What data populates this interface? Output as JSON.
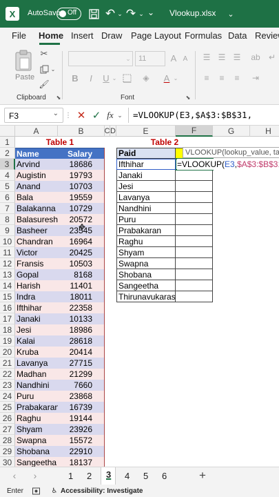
{
  "titlebar": {
    "autosave": "AutoSave",
    "toggle": "Off",
    "filename": "Vlookup.xlsx"
  },
  "tabs": [
    "File",
    "Home",
    "Insert",
    "Draw",
    "Page Layout",
    "Formulas",
    "Data",
    "Review"
  ],
  "ribbon": {
    "clipboard": "Clipboard",
    "paste": "Paste",
    "font_group": "Font",
    "font_size": "11"
  },
  "formula_bar": {
    "name_box": "F3",
    "fx": "fx",
    "formula": "=VLOOKUP(E3,$A$3:$B$31,"
  },
  "columns": [
    "A",
    "B",
    "C",
    "D",
    "E",
    "F",
    "G",
    "H"
  ],
  "rows": [
    "1",
    "2",
    "3",
    "4",
    "5",
    "6",
    "7",
    "8",
    "9",
    "10",
    "11",
    "12",
    "13",
    "14",
    "15",
    "16",
    "17",
    "18",
    "19",
    "20",
    "21",
    "22",
    "23",
    "24",
    "25",
    "26",
    "27",
    "28",
    "29",
    "30"
  ],
  "table1": {
    "title": "Table 1",
    "headers": [
      "Name",
      "Salary"
    ],
    "rows": [
      [
        "Arvind",
        "18686"
      ],
      [
        "Augistin",
        "19793"
      ],
      [
        "Anand",
        "10703"
      ],
      [
        "Bala",
        "19559"
      ],
      [
        "Balakanna",
        "10729"
      ],
      [
        "Balasuresh",
        "20572"
      ],
      [
        "Basheer",
        "23545"
      ],
      [
        "Chandran",
        "16964"
      ],
      [
        "Victor",
        "20425"
      ],
      [
        "Fransis",
        "10503"
      ],
      [
        "Gopal",
        "8168"
      ],
      [
        "Harish",
        "11401"
      ],
      [
        "Indra",
        "18011"
      ],
      [
        "Ifthihar",
        "22358"
      ],
      [
        "Janaki",
        "10133"
      ],
      [
        "Jesi",
        "18986"
      ],
      [
        "Kalai",
        "28618"
      ],
      [
        "Kruba",
        "20414"
      ],
      [
        "Lavanya",
        "27715"
      ],
      [
        "Madhan",
        "21299"
      ],
      [
        "Nandhini",
        "7660"
      ],
      [
        "Puru",
        "23868"
      ],
      [
        "Prabakaran",
        "16739"
      ],
      [
        "Raghu",
        "19144"
      ],
      [
        "Shyam",
        "23926"
      ],
      [
        "Swapna",
        "15572"
      ],
      [
        "Shobana",
        "22910"
      ],
      [
        "Sangeetha",
        "18137"
      ]
    ]
  },
  "table2": {
    "title": "Table 2",
    "header": "Paid",
    "names": [
      "Ifthihar",
      "Janaki",
      "Jesi",
      "Lavanya",
      "Nandhini",
      "Puru",
      "Prabakaran",
      "Raghu",
      "Shyam",
      "Swapna",
      "Shobana",
      "Sangeetha",
      "Thirunavukarasu"
    ]
  },
  "tooltip": "VLOOKUP(lookup_value, table_",
  "edit_formula": {
    "p1": "=VLOOKUP(",
    "p2": "E3",
    "p3": ",",
    "p4": "$A$3:$B$31",
    "p5": ","
  },
  "sheet_tabs": [
    "1",
    "2",
    "3",
    "4",
    "5",
    "6"
  ],
  "status": {
    "mode": "Enter",
    "accessibility": "Accessibility: Investigate"
  },
  "colors": {
    "excel_green": "#1e7145",
    "table1_header": "#4472c4",
    "title_red": "#c00000",
    "table1_band": "#d9d9ee"
  }
}
